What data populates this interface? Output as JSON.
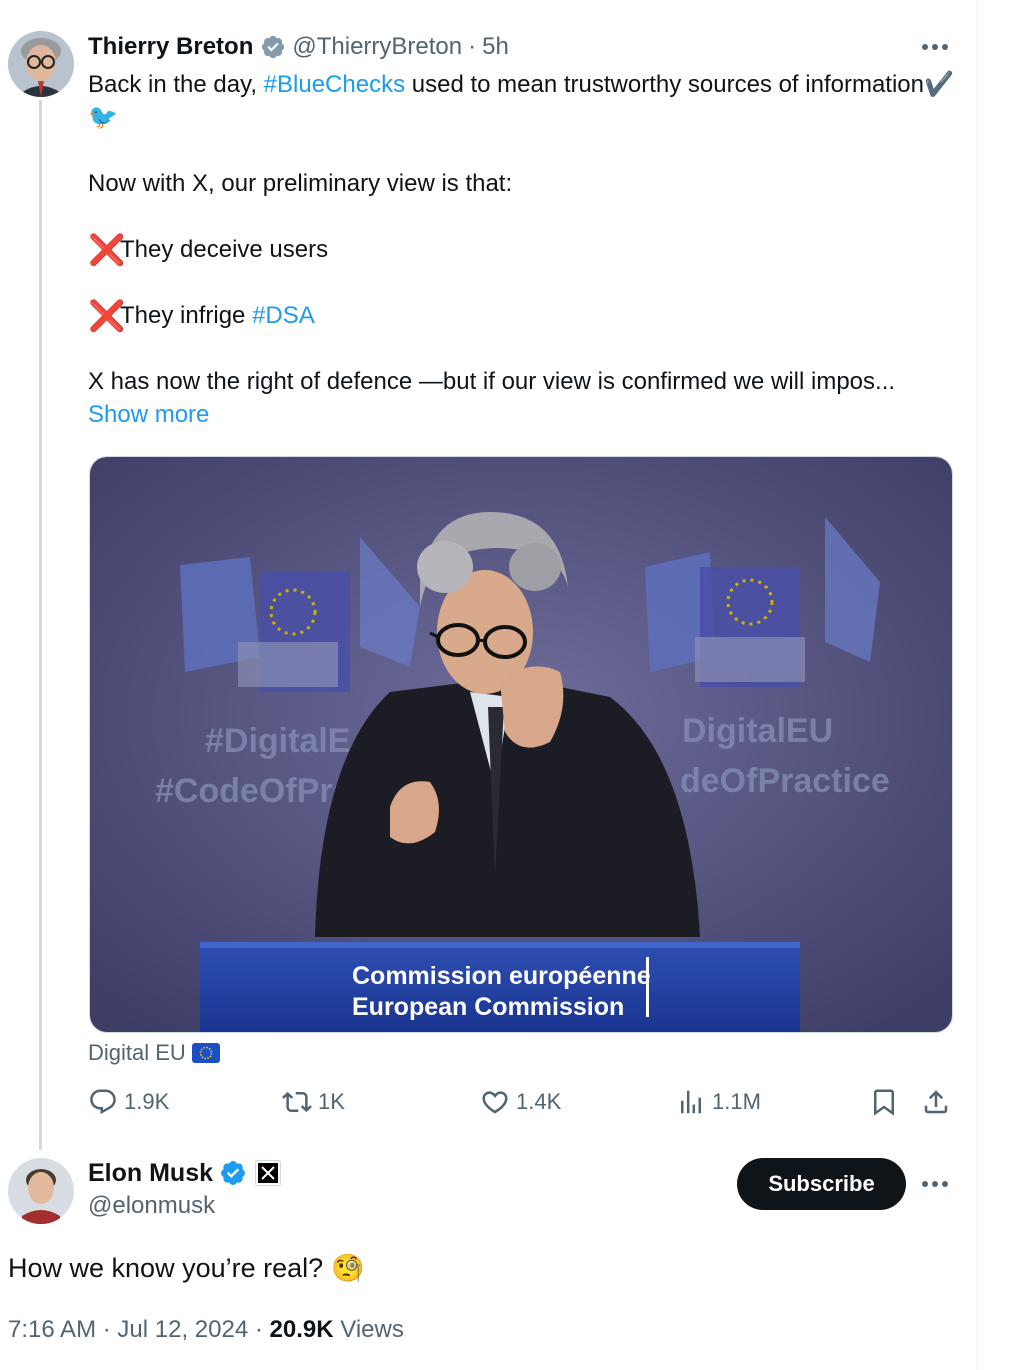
{
  "post": {
    "author_name": "Thierry Breton",
    "author_handle": "@ThierryBreton",
    "time_sep": "·",
    "time_ago": "5h",
    "line1_a": "Back in the day, ",
    "hashtag1": "#BlueChecks",
    "line1_b": " used to mean trustworthy sources of information",
    "line1_emoji": "✔️🐦",
    "line2": "Now with X, our preliminary view is that:",
    "cross_emoji": "❌",
    "line3": "They deceive users",
    "line4_a": "They infrige ",
    "hashtag2": "#DSA",
    "line5": "X has now the right of defence —but if our view is confirmed we will impos...",
    "show_more": "Show more",
    "media_caption": "Digital EU",
    "media": {
      "wall_left_line1": "#DigitalE",
      "wall_left_line2": "#CodeOfPra",
      "wall_right_line1": "DigitalEU",
      "wall_right_line2": "deOfPractice",
      "podium_line1": "Commission européenne",
      "podium_line2": "European Commission"
    },
    "stats": {
      "replies": "1.9K",
      "reposts": "1K",
      "likes": "1.4K",
      "views": "1.1M"
    }
  },
  "reply": {
    "author_name": "Elon Musk",
    "author_handle": "@elonmusk",
    "subscribe_label": "Subscribe",
    "text": "How we know you’re real?",
    "emoji": "🧐",
    "time": "7:16 AM",
    "sep": "·",
    "date": "Jul 12, 2024",
    "views_count": "20.9K",
    "views_label": "Views"
  },
  "colors": {
    "link_blue": "#1d9bf0",
    "text_main": "#0f1419",
    "text_muted": "#536471",
    "verified_gold": "#829aab",
    "verified_blue": "#1d9bf0"
  },
  "icons": [
    "verified-badge-icon",
    "more-icon",
    "reply-icon",
    "repost-icon",
    "like-icon",
    "views-icon",
    "bookmark-icon",
    "share-icon",
    "x-logo-icon",
    "eu-flag-icon"
  ]
}
